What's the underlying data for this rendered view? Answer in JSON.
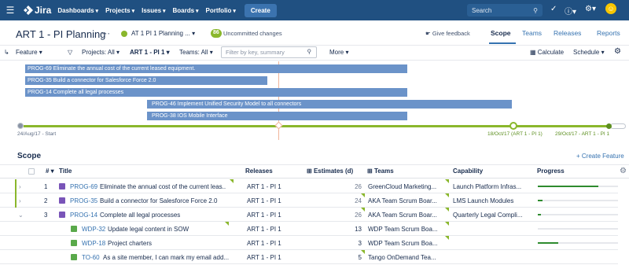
{
  "nav": {
    "logo": "Jira",
    "menus": [
      "Dashboards",
      "Projects",
      "Issues",
      "Boards",
      "Portfolio"
    ],
    "create": "Create",
    "search_placeholder": "Search"
  },
  "header": {
    "title": "ART 1 - PI Planning",
    "plan": "AT 1 PI 1 Planning ...",
    "uncommitted_count": "86",
    "uncommitted_label": "Uncommitted changes",
    "feedback": "Give feedback",
    "tabs": [
      "Scope",
      "Teams",
      "Releases",
      "Reports"
    ]
  },
  "toolbar": {
    "feature": "Feature",
    "projects": "Projects: All",
    "release": "ART 1 - PI 1",
    "teams": "Teams: All",
    "filter_placeholder": "Filter by key, summary",
    "more": "More",
    "calculate": "Calculate",
    "schedule": "Schedule"
  },
  "timeline": {
    "bars": [
      "PROG-69 Eliminate the annual cost of the current leased equipment.",
      "PROG-35 Build a connector for Salesforce Force 2.0",
      "PROG-14 Complete all legal processes",
      "PROG-46 Implement Unified Security Model to all connectors",
      "PROG-38 IOS Mobile Interface"
    ],
    "start_label": "24/Aug/17 - Start",
    "pi_label": "18/Oct/17 (ART 1 - PI 1)",
    "end_label": "29/Oct/17 - ART 1 - PI 1"
  },
  "scope": {
    "heading": "Scope",
    "create_feature": "+ Create Feature",
    "columns": [
      "#",
      "Title",
      "Releases",
      "Estimates (d)",
      "Teams",
      "Capability",
      "Progress"
    ],
    "rows": [
      {
        "num": "1",
        "key": "PROG-69",
        "title": "Eliminate the annual cost of the current leas...",
        "release": "ART 1 - PI 1",
        "estimate": "26",
        "team": "GreenCloud Marketing...",
        "capability": "Launch Platform Infras...",
        "progress": 0.75
      },
      {
        "num": "2",
        "key": "PROG-35",
        "title": "Build a connector for Salesforce Force 2.0",
        "release": "ART 1 - PI 1",
        "estimate": "24",
        "team": "AKA Team Scrum Boar...",
        "capability": "LMS Launch Modules",
        "progress": 0.06
      },
      {
        "num": "3",
        "key": "PROG-14",
        "title": "Complete all legal processes",
        "release": "ART 1 - PI 1",
        "estimate": "26",
        "team": "AKA Team Scrum Boar...",
        "capability": "Quarterly Legal Compli...",
        "progress": 0.04
      },
      {
        "num": "",
        "key": "WDP-32",
        "title": "Update legal content in SOW",
        "release": "ART 1 - PI 1",
        "estimate": "13",
        "team": "WDP Team Scrum Boa...",
        "capability": "",
        "progress": 0
      },
      {
        "num": "",
        "key": "WDP-18",
        "title": "Project charters",
        "release": "ART 1 - PI 1",
        "estimate": "3",
        "team": "WDP Team Scrum Boa...",
        "capability": "",
        "progress": 0.25
      },
      {
        "num": "",
        "key": "TO-60",
        "title": "As a site member, I can mark my email add...",
        "release": "ART 1 - PI 1",
        "estimate": "5",
        "team": "Tango OnDemand Tea...",
        "capability": "",
        "progress": 0
      }
    ]
  }
}
